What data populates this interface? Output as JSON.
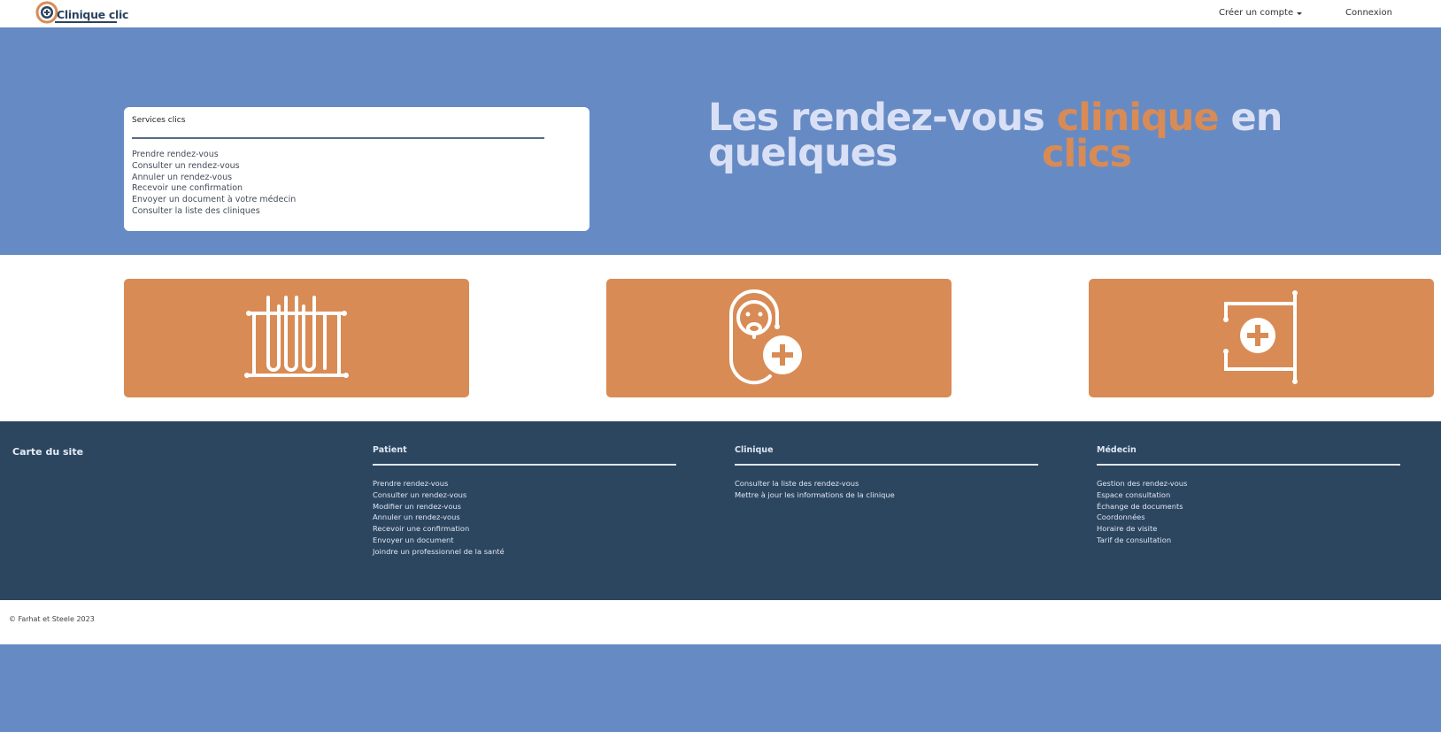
{
  "navbar": {
    "brand": "Clinique clic",
    "create_account": "Créer un compte",
    "login": "Connexion"
  },
  "hero": {
    "services_title": "Services clics",
    "services": [
      "Prendre rendez-vous",
      "Consulter un rendez-vous",
      "Annuler un rendez-vous",
      "Recevoir une confirmation",
      "Envoyer un document à votre médecin",
      "Consulter la liste des cliniques"
    ],
    "title_part1": "Les rendez-vous ",
    "title_accent": "clinique",
    "title_part2": " en quelques",
    "title_line2": "clics"
  },
  "features": {
    "icons": [
      "test-tubes-icon",
      "patient-oxygen-mask-icon",
      "clinic-sign-icon"
    ]
  },
  "footer": {
    "sitemap_title": "Carte du site",
    "columns": [
      {
        "title": "Patient",
        "links": [
          "Prendre rendez-vous",
          "Consulter un rendez-vous",
          "Modifier un rendez-vous",
          "Annuler un rendez-vous",
          "Recevoir une confirmation",
          "Envoyer un document",
          "Joindre un professionnel de la santé"
        ]
      },
      {
        "title": "Clinique",
        "links": [
          "Consulter la liste des rendez-vous",
          "Mettre à jour les informations de la clinique"
        ]
      },
      {
        "title": "Médecin",
        "links": [
          "Gestion des rendez-vous",
          "Espace consultation",
          "Échange de documents",
          "Coordonnées",
          "Horaire de visite",
          "Tarif de consultation"
        ]
      }
    ]
  },
  "copyright": "© Farhat et Steele 2023",
  "colors": {
    "hero_bg": "#668bc4",
    "accent": "#d98b55",
    "footer_bg": "#2c4660",
    "brand_text": "#2c4460"
  }
}
